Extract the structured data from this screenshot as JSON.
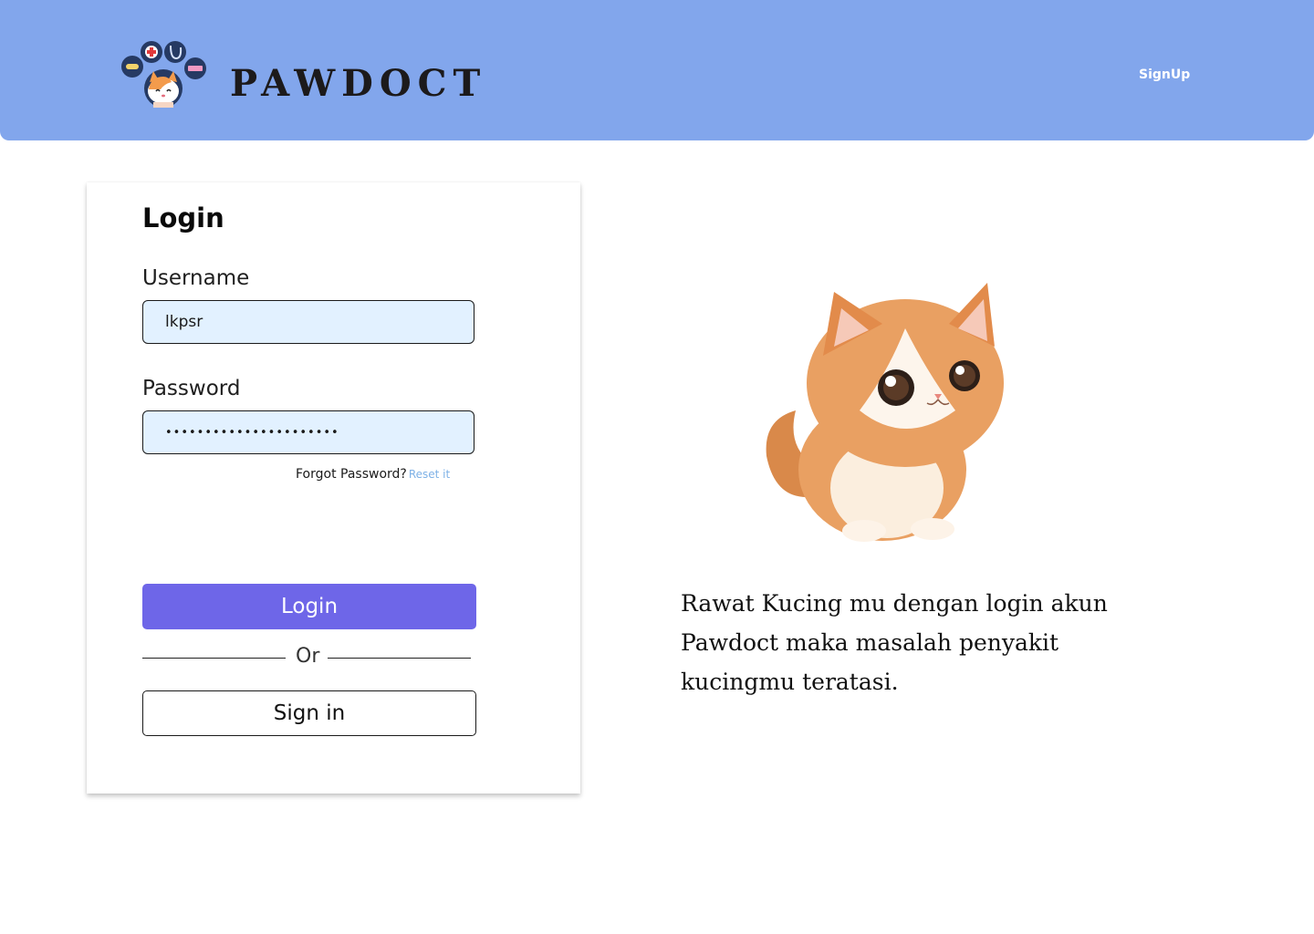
{
  "header": {
    "brand": "PAWDOCT",
    "signup_label": "SignUp",
    "background": "#82a6ec"
  },
  "login_card": {
    "title": "Login",
    "username": {
      "label": "Username",
      "value": "lkpsr"
    },
    "password": {
      "label": "Password",
      "masked_value": "••••••••••••••••••••••"
    },
    "forgot": {
      "text": "Forgot Password?",
      "link": "Reset it"
    },
    "login_button": "Login",
    "divider": "Or",
    "signin_button": "Sign in",
    "colors": {
      "input_bg": "#e2f1ff",
      "primary": "#6e66e8",
      "link": "#7eb1e6"
    }
  },
  "hero": {
    "tagline": "Rawat Kucing mu dengan login akun Pawdoct maka masalah penyakit kucingmu teratasi.",
    "image": "kitten-illustration"
  },
  "icons": [
    "paw-logo-icon",
    "medical-cross-icon",
    "stethoscope-icon",
    "pill-icon",
    "syringe-icon"
  ]
}
